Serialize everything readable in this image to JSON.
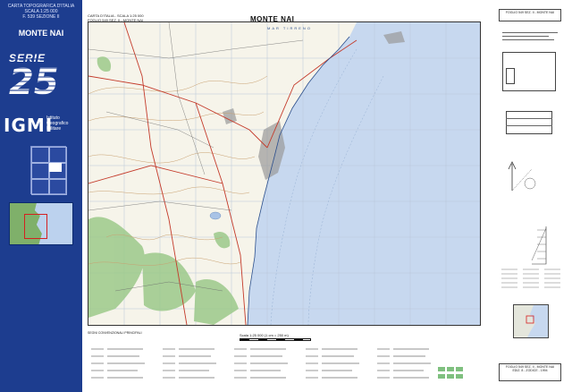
{
  "left_band": {
    "header_line1": "CARTA TOPOGRAFICA D'ITALIA",
    "header_line2": "SCALA 1:25 000",
    "header_line3": "F. 539 SEZIONE II",
    "sheet_name": "MONTE NAI",
    "series_label": "SERIE",
    "series_number": "25",
    "agency": "IGMI",
    "agency_full_1": "Istituto",
    "agency_full_2": "Geografico",
    "agency_full_3": "Militare"
  },
  "map": {
    "top_info_1": "CARTA D'ITALIA - SCALA 1:25 000",
    "top_info_2": "FOGLIO 549 SEZ. II - MONTE NAI",
    "title": "MONTE NAI",
    "sea_label": "MAR TIRRENO"
  },
  "right_panel": {
    "top_box": "FOGLIO 549 SEZ. II - MONTE NAI",
    "bottom_box_1": "FOGLIO 549 SEZ. II - MONTE NAI",
    "bottom_box_2": "EDIZ. 8 - ZODICE - 1994"
  },
  "legend": {
    "title": "SEGNI CONVENZIONALI PRINCIPALI",
    "scale": "Scala 1:25 000 (1 cm = 250 m)"
  },
  "colors": {
    "band_blue": "#1d3d8f",
    "sea_blue": "#c7d8ef",
    "land": "#f6f4ea",
    "forest_green": "#9cc98a",
    "road_red": "#c43a2a",
    "urban_gray": "#9a9a9a"
  },
  "icons": {
    "locator_map": "locator-map-icon",
    "north_arrow": "north-arrow-icon"
  }
}
